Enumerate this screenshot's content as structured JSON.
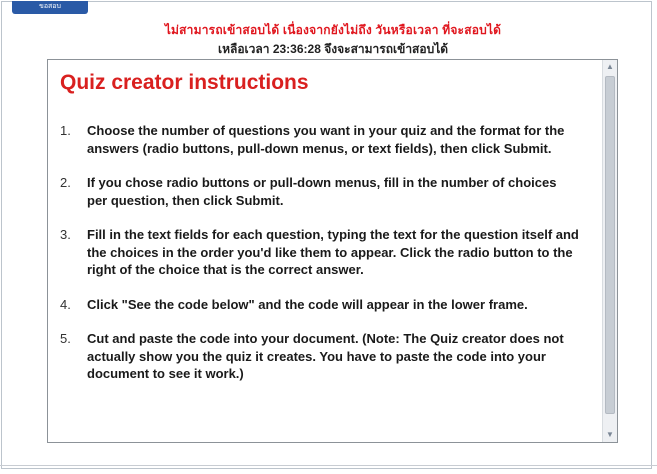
{
  "tab": {
    "label": "ขอสอบ"
  },
  "status": {
    "line1": "ไม่สามารถเข้าสอบได้ เนื่องจากยังไม่ถึง วันหรือเวลา ที่จะสอบได้",
    "line2_prefix": "เหลือเวลา",
    "line2_time": "23:36:28",
    "line2_suffix": "จึงจะสามารถเข้าสอบได้"
  },
  "content": {
    "title": "Quiz creator instructions",
    "items": [
      {
        "num": "1.",
        "text": "Choose the number of questions you want in your quiz and the format for the answers (radio buttons, pull-down menus, or text fields), then click Submit."
      },
      {
        "num": "2.",
        "text": "If you chose radio buttons or pull-down menus, fill in the number of choices per question, then click Submit."
      },
      {
        "num": "3.",
        "text": "Fill in the text fields for each question, typing the text for the question itself and the choices in the order you'd like them to appear. Click the radio button to the right of the choice that is the correct answer."
      },
      {
        "num": "4.",
        "text": "Click \"See the code below\" and the code will appear in the lower frame."
      },
      {
        "num": "5.",
        "text": "Cut and paste the code into your document. (Note: The Quiz creator does not actually show you the quiz it creates. You have to paste the code into your document to see it work.)"
      }
    ]
  },
  "scrollbar": {
    "up_icon": "▲",
    "down_icon": "▼"
  },
  "colors": {
    "title": "#d9201f",
    "status_warning": "#e0161e",
    "tab": "#2a5aa6"
  }
}
